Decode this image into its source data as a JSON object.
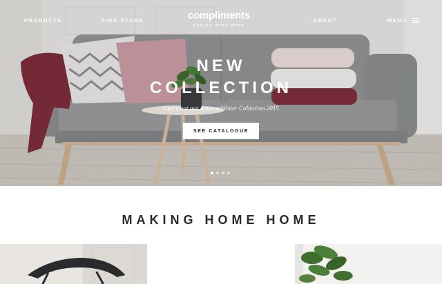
{
  "nav": {
    "products": "PRODUCTS",
    "find_store": "FIND STORE",
    "about": "ABOUT",
    "menu": "MENU"
  },
  "brand": {
    "name": "compliments",
    "tagline": "MAKING HOME HOME"
  },
  "hero": {
    "title_line1": "NEW",
    "title_line2": "COLLECTION",
    "subtitle": "Check out our Autumn/Winter Collection 2015",
    "cta": "SEE CATALOGUE",
    "slides_count": 4,
    "active_slide": 1
  },
  "section": {
    "title": "MAKING HOME HOME"
  },
  "colors": {
    "sofa": "#8e8f91",
    "burgundy": "#7b2c3a",
    "pink": "#c89aa3",
    "accent_white": "#ffffff"
  }
}
